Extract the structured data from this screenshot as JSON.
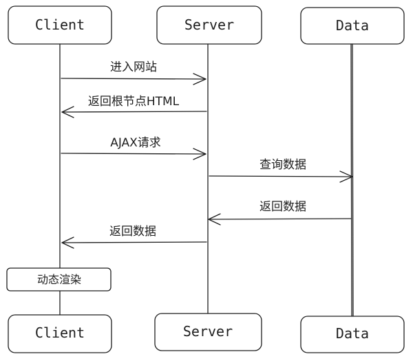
{
  "diagram": {
    "type": "sequence",
    "participants": [
      {
        "id": "client",
        "label": "Client"
      },
      {
        "id": "server",
        "label": "Server"
      },
      {
        "id": "data",
        "label": "Data"
      }
    ],
    "messages": [
      {
        "from": "client",
        "to": "server",
        "label": "进入网站"
      },
      {
        "from": "server",
        "to": "client",
        "label": "返回根节点HTML"
      },
      {
        "from": "client",
        "to": "server",
        "label": "AJAX请求"
      },
      {
        "from": "server",
        "to": "data",
        "label": "查询数据"
      },
      {
        "from": "data",
        "to": "server",
        "label": "返回数据"
      },
      {
        "from": "server",
        "to": "client",
        "label": "返回数据"
      }
    ],
    "note": {
      "over": "client",
      "label": "动态渲染"
    }
  }
}
